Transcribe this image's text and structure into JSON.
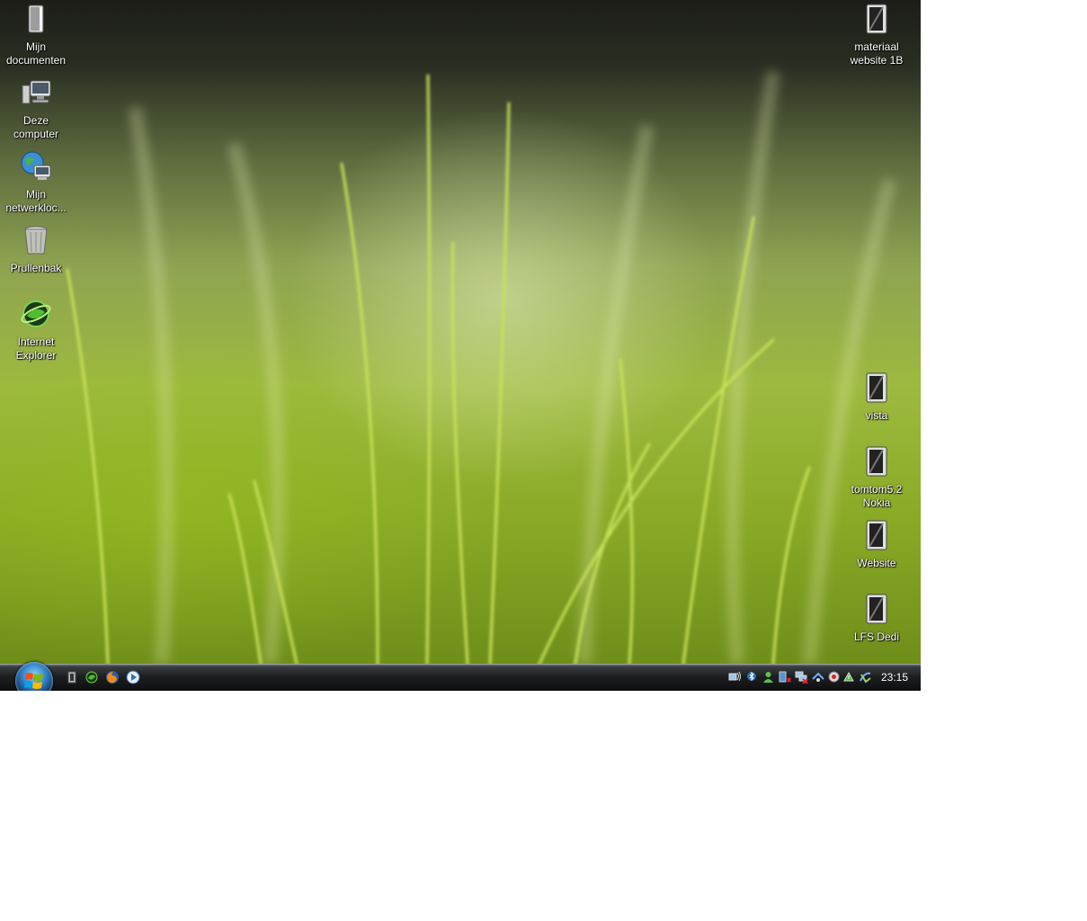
{
  "desktop": {
    "left_icons": [
      {
        "label_line1": "Mijn",
        "label_line2": "documenten",
        "icon": "folder-icon"
      },
      {
        "label_line1": "Deze",
        "label_line2": "computer",
        "icon": "computer-icon"
      },
      {
        "label_line1": "Mijn",
        "label_line2": "netwerkloc...",
        "icon": "network-icon"
      },
      {
        "label_line1": "Prullenbak",
        "label_line2": "",
        "icon": "recycle-bin-icon"
      },
      {
        "label_line1": "Internet",
        "label_line2": "Explorer",
        "icon": "internet-explorer-icon"
      }
    ],
    "right_icons": [
      {
        "label_line1": "materiaal",
        "label_line2": "website 1B",
        "icon": "folder-icon"
      },
      {
        "label_line1": "vista",
        "label_line2": "",
        "icon": "folder-icon"
      },
      {
        "label_line1": "tomtom5.2",
        "label_line2": "Nokia",
        "icon": "folder-icon"
      },
      {
        "label_line1": "Website",
        "label_line2": "",
        "icon": "folder-icon"
      },
      {
        "label_line1": "LFS Dedi",
        "label_line2": "",
        "icon": "folder-icon"
      }
    ]
  },
  "taskbar": {
    "start_button": "start-orb-icon",
    "quick_launch": [
      "show-desktop-icon",
      "internet-explorer-icon",
      "firefox-icon",
      "media-player-icon"
    ],
    "tray_icons": [
      "wireless-network-icon",
      "bluetooth-icon",
      "messenger-icon",
      "volume-icon",
      "network-disconnected-icon",
      "network-icon",
      "antivirus-icon",
      "update-icon",
      "sync-icon"
    ],
    "clock": "23:15"
  },
  "colors": {
    "wallpaper_dark": "#1c1d18",
    "wallpaper_green": "#9dba3f",
    "taskbar": "#1d1f21",
    "label_text": "#ffffff",
    "page_background": "#ffffff"
  }
}
